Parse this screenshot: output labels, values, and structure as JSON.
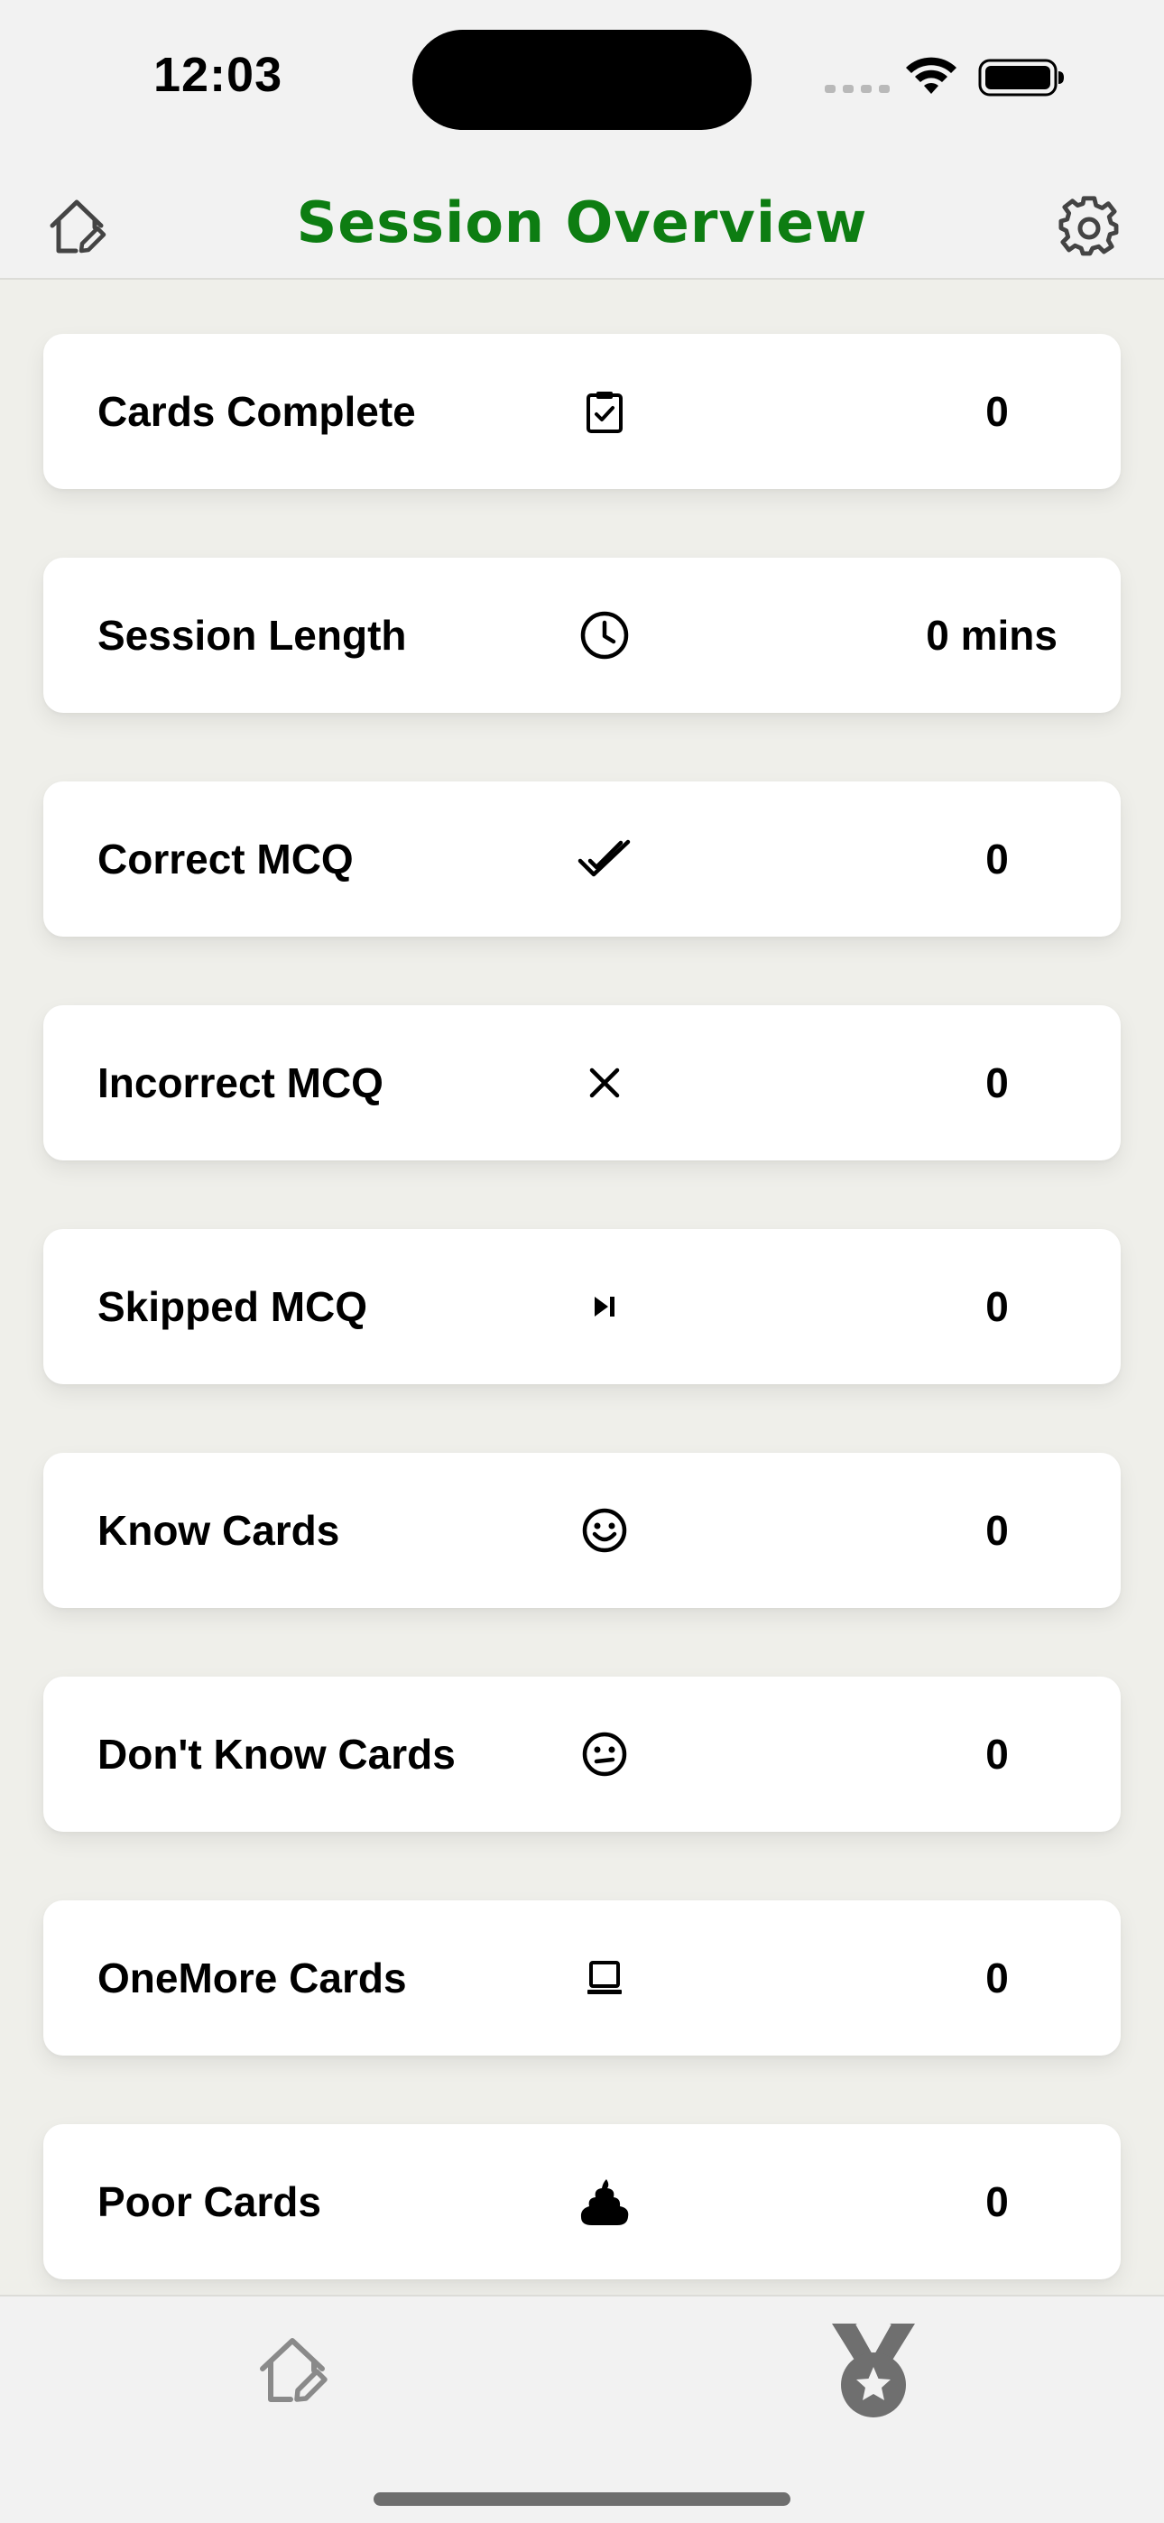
{
  "status_bar": {
    "time": "12:03"
  },
  "nav": {
    "title": "Session Overview",
    "left_icon": "home-edit-icon",
    "right_icon": "gear-icon",
    "title_color": "#0d7d12"
  },
  "stats": [
    {
      "label": "Cards Complete",
      "icon": "clipboard-check-icon",
      "value": "0"
    },
    {
      "label": "Session Length",
      "icon": "clock-icon",
      "value": "0 mins"
    },
    {
      "label": "Correct MCQ",
      "icon": "double-check-icon",
      "value": "0"
    },
    {
      "label": "Incorrect MCQ",
      "icon": "x-mark-icon",
      "value": "0"
    },
    {
      "label": "Skipped MCQ",
      "icon": "skip-forward-icon",
      "value": "0"
    },
    {
      "label": "Know Cards",
      "icon": "smile-face-icon",
      "value": "0"
    },
    {
      "label": "Don't Know Cards",
      "icon": "neutral-face-icon",
      "value": "0"
    },
    {
      "label": "OneMore Cards",
      "icon": "laptop-icon",
      "value": "0"
    },
    {
      "label": "Poor Cards",
      "icon": "poop-icon",
      "value": "0"
    }
  ],
  "tab_bar": {
    "items": [
      {
        "icon": "home-edit-icon",
        "active": false
      },
      {
        "icon": "medal-icon",
        "active": true
      }
    ]
  }
}
